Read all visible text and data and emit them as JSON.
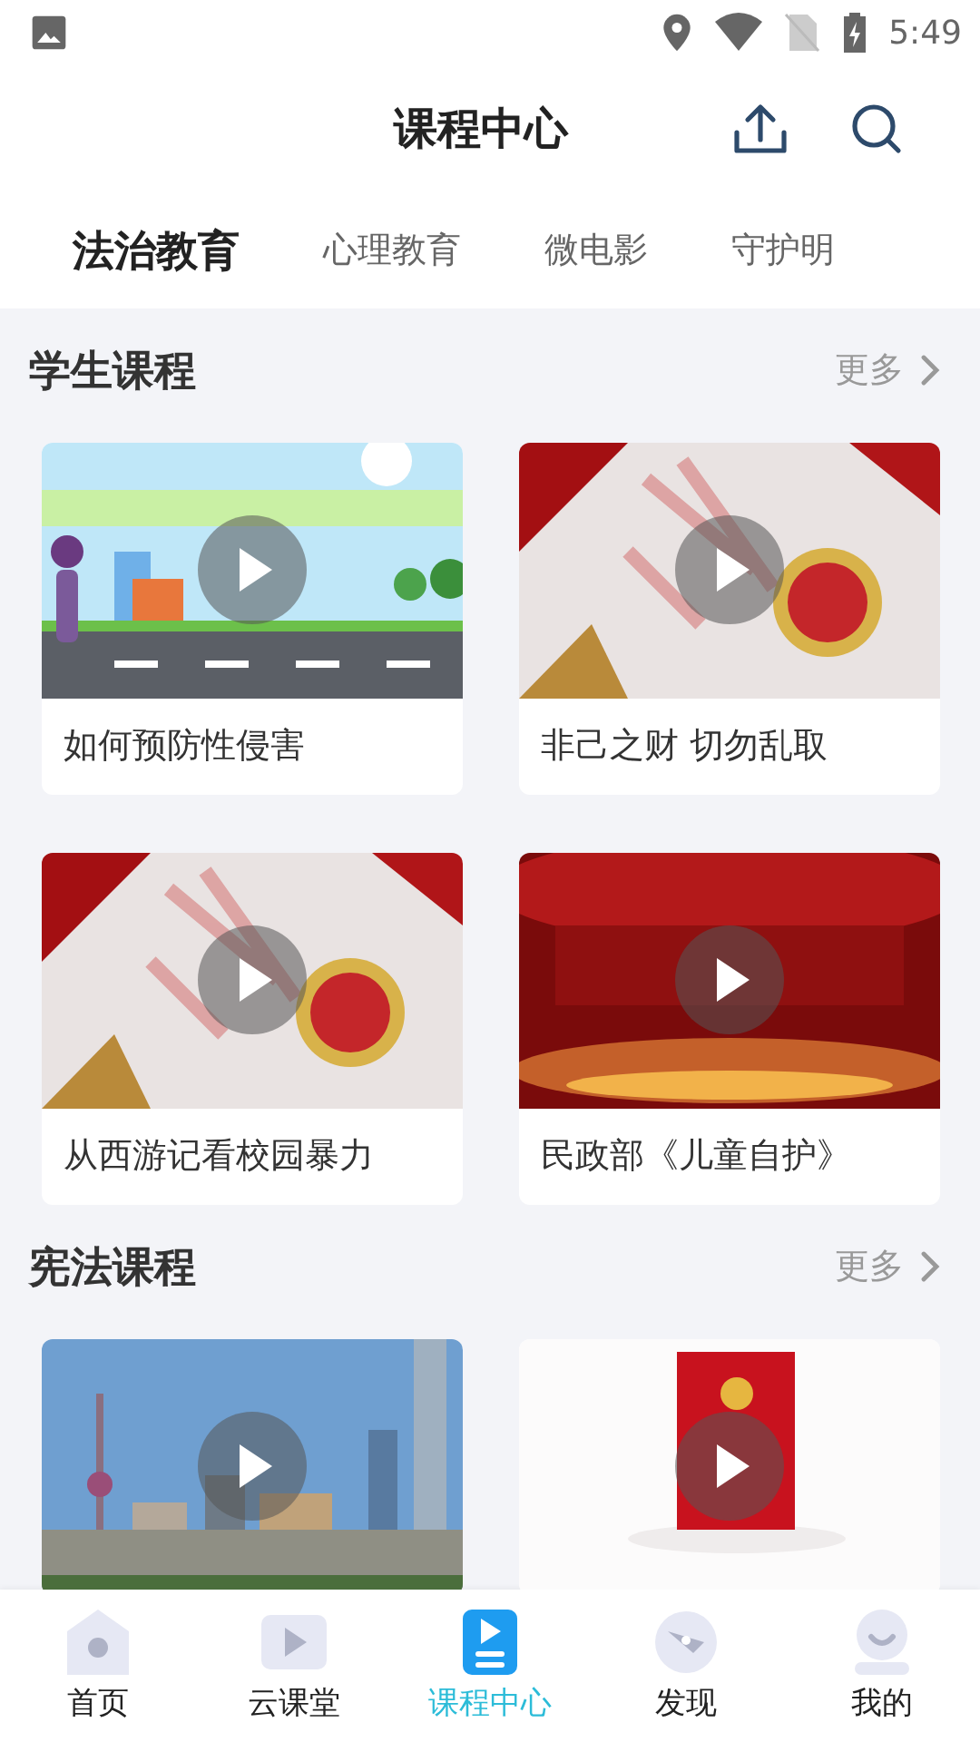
{
  "status_bar": {
    "time": "5:49"
  },
  "header": {
    "title": "课程中心"
  },
  "tabs": [
    {
      "label": "法治教育",
      "selected": true
    },
    {
      "label": "心理教育",
      "selected": false
    },
    {
      "label": "微电影",
      "selected": false
    },
    {
      "label": "守护明",
      "selected": false
    }
  ],
  "sections": [
    {
      "title": "学生课程",
      "more": "更多",
      "courses": [
        {
          "title": "如何预防性侵害"
        },
        {
          "title": "非己之财 切勿乱取"
        },
        {
          "title": "从西游记看校园暴力"
        },
        {
          "title": "民政部《儿童自护》"
        }
      ]
    },
    {
      "title": "宪法课程",
      "more": "更多"
    }
  ],
  "bottom_nav": [
    {
      "label": "首页",
      "selected": false
    },
    {
      "label": "云课堂",
      "selected": false
    },
    {
      "label": "课程中心",
      "selected": true
    },
    {
      "label": "发现",
      "selected": false
    },
    {
      "label": "我的",
      "selected": false
    }
  ]
}
